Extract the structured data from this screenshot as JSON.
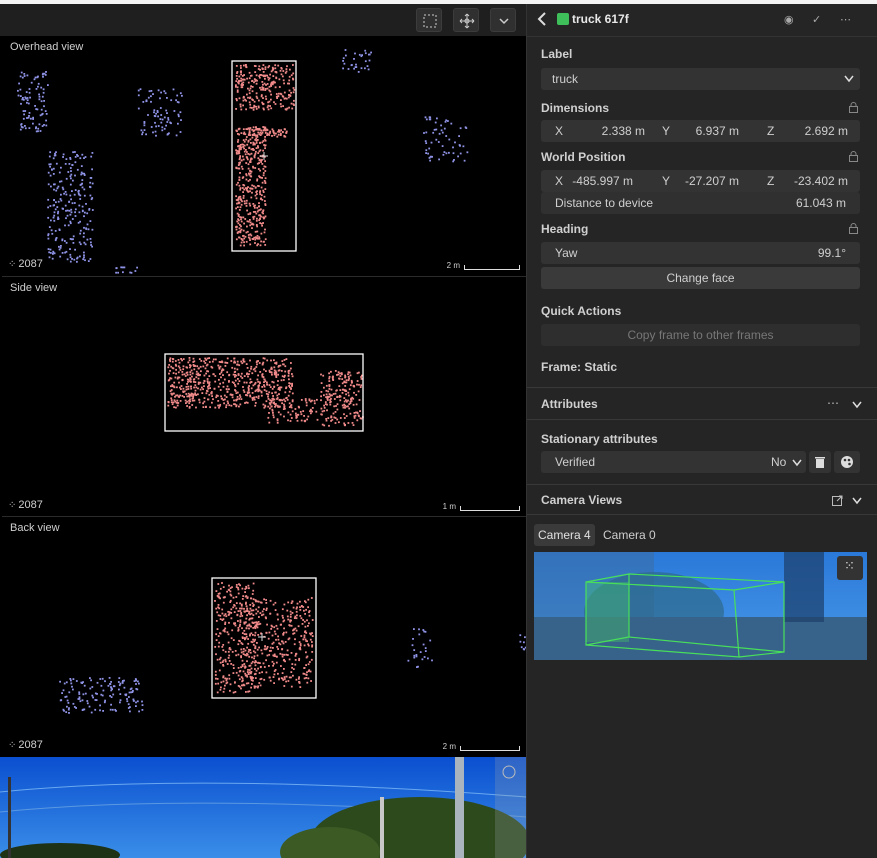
{
  "toolbar": {
    "buttons": [
      "select-icon",
      "move-icon",
      "chevron-down-icon"
    ]
  },
  "views": {
    "overhead": {
      "title": "Overhead view",
      "frame": "2087",
      "scale": "2 m"
    },
    "side": {
      "title": "Side view",
      "frame": "2087",
      "scale": "1 m"
    },
    "back": {
      "title": "Back view",
      "frame": "2087",
      "scale": "2 m"
    }
  },
  "panel": {
    "header": {
      "title": "truck 617f",
      "color": "#3fbf5a"
    },
    "label": {
      "heading": "Label",
      "value": "truck"
    },
    "dimensions": {
      "heading": "Dimensions",
      "x_label": "X",
      "x": "2.338 m",
      "y_label": "Y",
      "y": "6.937 m",
      "z_label": "Z",
      "z": "2.692 m"
    },
    "world_position": {
      "heading": "World Position",
      "x_label": "X",
      "x": "-485.997 m",
      "y_label": "Y",
      "y": "-27.207 m",
      "z_label": "Z",
      "z": "-23.402 m",
      "distance_label": "Distance to device",
      "distance": "61.043 m"
    },
    "heading": {
      "heading": "Heading",
      "yaw_label": "Yaw",
      "yaw": "99.1°",
      "change_face": "Change face"
    },
    "quick_actions": {
      "heading": "Quick Actions",
      "copy_frame": "Copy frame to other frames"
    },
    "frame": "Frame: Static",
    "attributes": {
      "heading": "Attributes"
    },
    "stationary": {
      "heading": "Stationary attributes",
      "verified_label": "Verified",
      "verified_value": "No"
    },
    "camera_views": {
      "heading": "Camera Views",
      "tabs": [
        "Camera 4",
        "Camera 0"
      ],
      "active": "Camera 4"
    }
  },
  "colors": {
    "point_target": "#f08a8a",
    "point_other": "#8f93e6",
    "box": "#ffffff",
    "accent_green": "#3fbf5a"
  }
}
